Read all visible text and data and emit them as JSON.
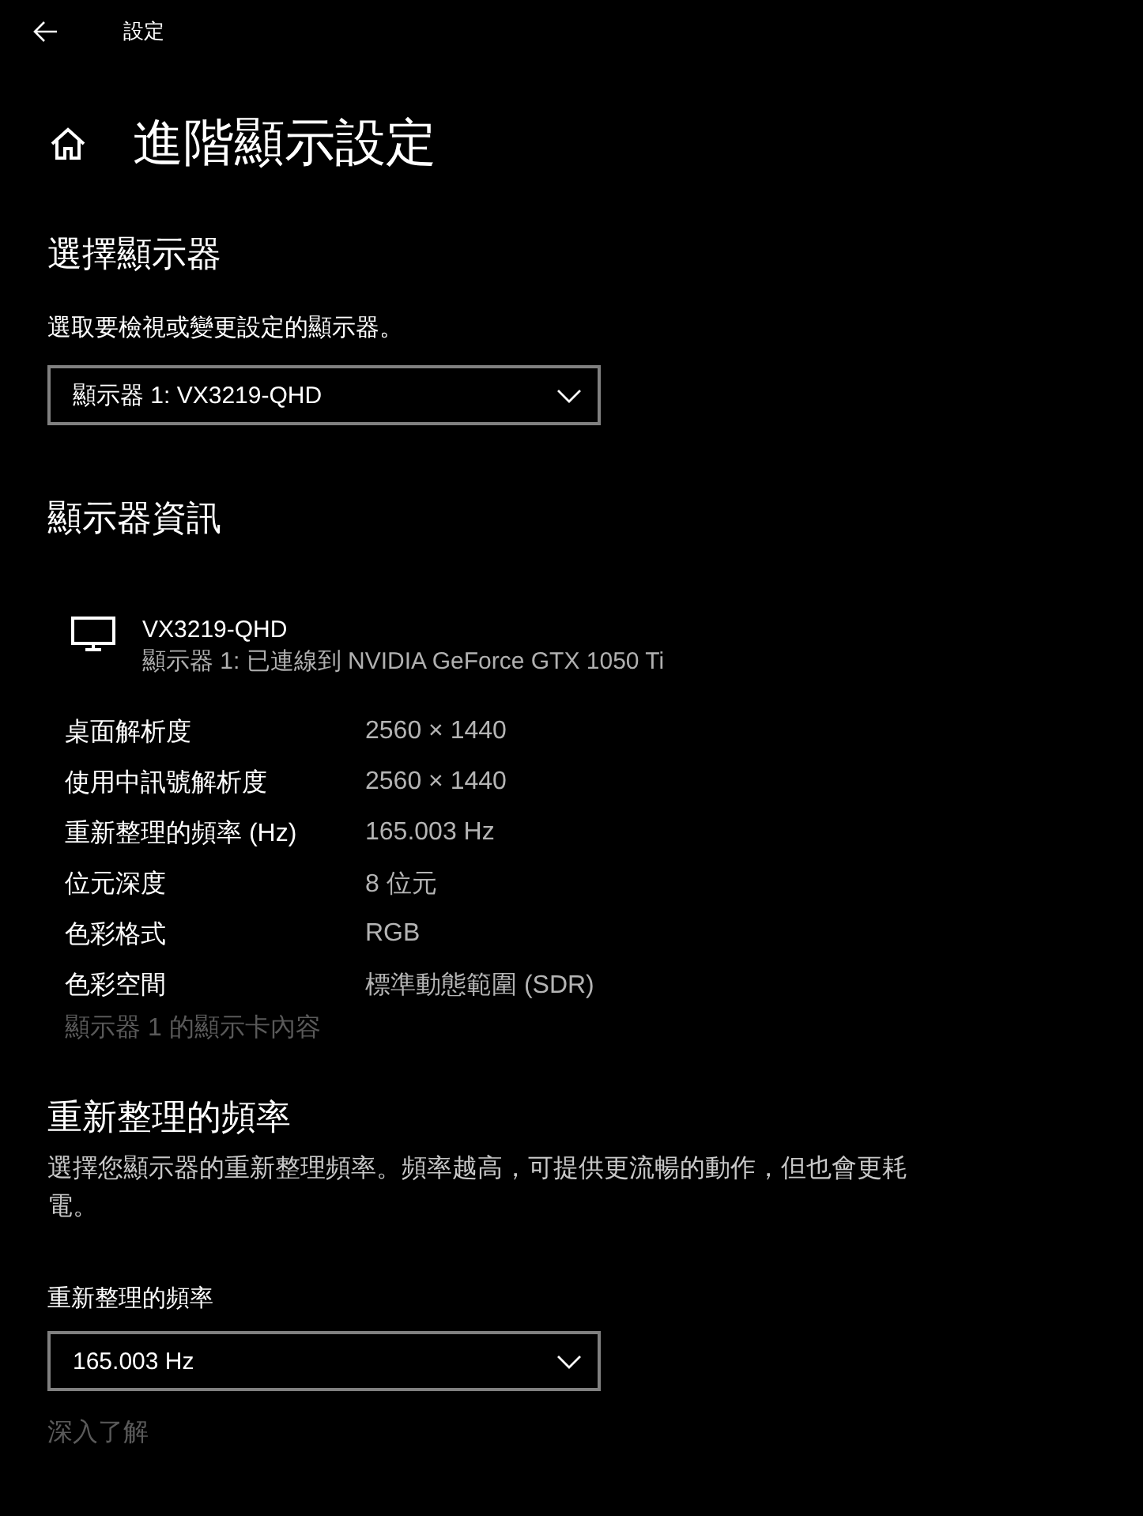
{
  "window": {
    "title": "設定"
  },
  "page_title": "進階顯示設定",
  "select_display": {
    "heading": "選擇顯示器",
    "description": "選取要檢視或變更設定的顯示器。",
    "dropdown": {
      "value": "顯示器 1: VX3219-QHD"
    }
  },
  "display_info": {
    "heading": "顯示器資訊",
    "monitor": {
      "name": "VX3219-QHD",
      "subtitle": "顯示器 1: 已連線到 NVIDIA GeForce GTX 1050 Ti"
    },
    "rows": [
      {
        "label": "桌面解析度",
        "value": "2560 × 1440"
      },
      {
        "label": "使用中訊號解析度",
        "value": "2560 × 1440"
      },
      {
        "label": "重新整理的頻率 (Hz)",
        "value": "165.003 Hz"
      },
      {
        "label": "位元深度",
        "value": "8 位元"
      },
      {
        "label": "色彩格式",
        "value": "RGB"
      },
      {
        "label": "色彩空間",
        "value": "標準動態範圍 (SDR)"
      }
    ],
    "link": {
      "text": "顯示器 1 的顯示卡內容",
      "disabled": true
    }
  },
  "refresh_rate": {
    "heading": "重新整理的頻率",
    "description": "選擇您顯示器的重新整理頻率。頻率越高，可提供更流暢的動作，但也會更耗電。",
    "label": "重新整理的頻率",
    "dropdown": {
      "value": "165.003 Hz"
    },
    "link": {
      "text": "深入了解",
      "disabled": true
    }
  }
}
